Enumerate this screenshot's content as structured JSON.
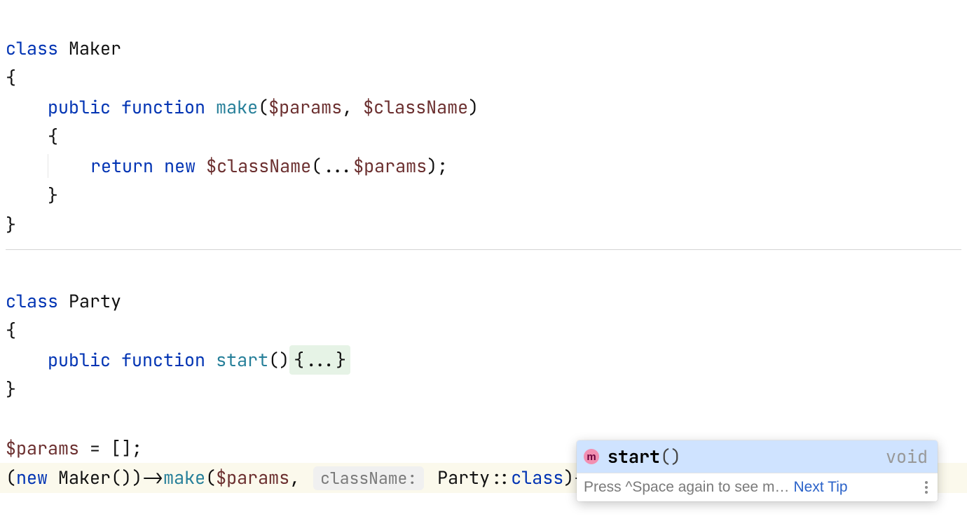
{
  "code": {
    "class_kw": "class",
    "maker_name": "Maker",
    "party_name": "Party",
    "open_brace": "{",
    "close_brace": "}",
    "public_kw": "public",
    "function_kw": "function",
    "make_fn": "make",
    "start_fn": "start",
    "params_var": "$params",
    "classname_var": "$className",
    "return_kw": "return",
    "new_kw": "new",
    "spread": "...",
    "fold_body": "{...}",
    "params_init": "$params = [];",
    "maker_call_open": "(",
    "maker_call_close": "())->",
    "make_open": "(",
    "comma_sp": ", ",
    "param_hint_label": "className:",
    "party_ref": "Party",
    "scope": "::",
    "class_const": "class",
    "call_close": ")->",
    "semi": ";"
  },
  "popup": {
    "icon_letter": "m",
    "suggestion": "start",
    "parens": "()",
    "type": "void",
    "hint_prefix": "Press ",
    "hint_key": "^Space",
    "hint_rest": " again to see m…",
    "next_tip": "Next Tip"
  }
}
